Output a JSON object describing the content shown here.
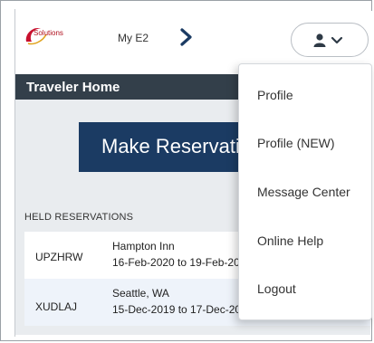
{
  "topbar": {
    "logo_text": "Solutions",
    "nav_link": "My E2",
    "icons": {
      "nav": "chevron-right-icon",
      "user": "user-icon",
      "toggle": "chevron-down-icon"
    },
    "colors": {
      "chevron": "#1b3b63",
      "user_icon": "#2e3a46"
    }
  },
  "header": {
    "title": "Traveler Home"
  },
  "main": {
    "reserve_button": "Make Reservation",
    "held_label": "HELD RESERVATIONS",
    "reservations": [
      {
        "code": "UPZHRW",
        "place": "Hampton Inn",
        "dates": "16-Feb-2020 to 19-Feb-2020"
      },
      {
        "code": "XUDLAJ",
        "place": "Seattle, WA",
        "dates": "15-Dec-2019 to 17-Dec-2019"
      }
    ]
  },
  "dropdown": {
    "items": [
      "Profile",
      "Profile (NEW)",
      "Message Center",
      "Online Help",
      "Logout"
    ]
  }
}
